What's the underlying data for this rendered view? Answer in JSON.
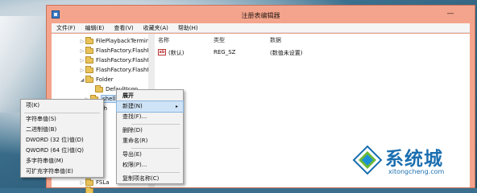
{
  "window": {
    "title": "注册表编辑器",
    "minimize_glyph": "—"
  },
  "menubar": [
    "文件(F)",
    "编辑(E)",
    "查看(V)",
    "收藏夹(A)",
    "帮助(H)"
  ],
  "tree": {
    "items": [
      {
        "label": "FilePlaybackTerminal",
        "arrow": "▷"
      },
      {
        "label": "FlashFactory.FlashFa",
        "arrow": "▷"
      },
      {
        "label": "FlashFactory.FlashFa",
        "arrow": "▷"
      },
      {
        "label": "FlashFactory.FlashFa",
        "arrow": "▷"
      },
      {
        "label": "Folder",
        "arrow": "◢"
      },
      {
        "label": "DefaultIcon",
        "arrow": ""
      },
      {
        "label": "shell",
        "arrow": "▷",
        "selected": true
      },
      {
        "label": "sh",
        "arrow": "▷"
      },
      {
        "label": "FSLa",
        "arrow": "▷"
      },
      {
        "label": "",
        "arrow": "▷"
      }
    ]
  },
  "values": {
    "headers": {
      "name": "名称",
      "type": "类型",
      "data": "数据"
    },
    "rows": [
      {
        "icon": "ab",
        "name": "(默认)",
        "type": "REG_SZ",
        "data": "(数值未设置)"
      }
    ]
  },
  "context_menu": {
    "items": [
      "展开",
      "新建(N)",
      "查找(F)...",
      "删除(D)",
      "重命名(R)",
      "导出(E)",
      "权限(P)...",
      "复制项名称(C)"
    ],
    "submenu_arrow": "▸"
  },
  "new_submenu": {
    "items": [
      "项(K)",
      "字符串值(S)",
      "二进制值(B)",
      "DWORD (32 位)值(D)",
      "QWORD (64 位)值(Q)",
      "多字符串值(M)",
      "可扩充字符串值(E)"
    ]
  },
  "watermark": {
    "brand": "系统城",
    "url": "xitongcheng.com"
  },
  "colors": {
    "title_bar": "#f4a48c",
    "selection": "#cfe3f7",
    "watermark": "#1b6fb0"
  }
}
